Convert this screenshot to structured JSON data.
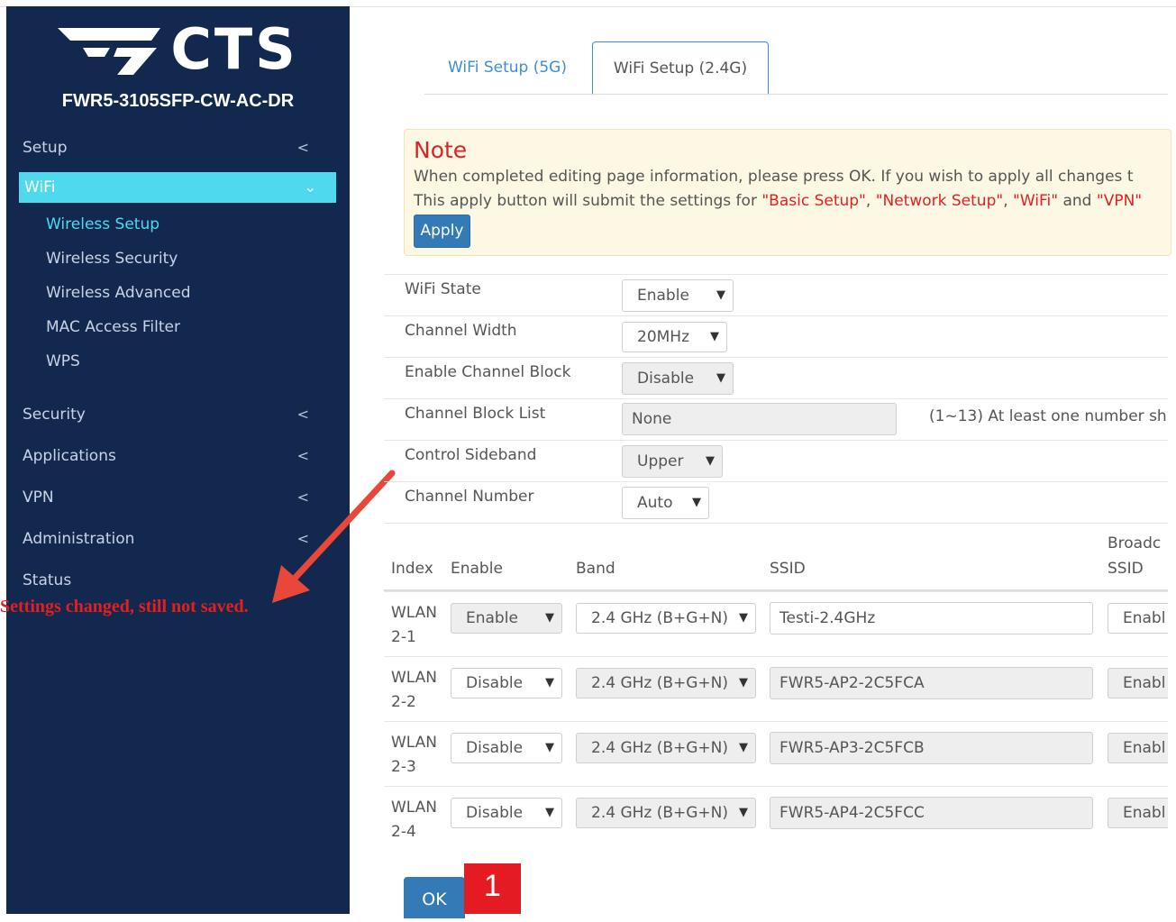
{
  "brand": {
    "logo_text": "CTS",
    "model": "FWR5-3105SFP-CW-AC-DR"
  },
  "sidebar": {
    "items": [
      {
        "label": "Setup",
        "chevron": "<"
      },
      {
        "label": "WiFi",
        "chevron": "⌄"
      },
      {
        "label": "Security",
        "chevron": "<"
      },
      {
        "label": "Applications",
        "chevron": "<"
      },
      {
        "label": "VPN",
        "chevron": "<"
      },
      {
        "label": "Administration",
        "chevron": "<"
      },
      {
        "label": "Status"
      }
    ],
    "wifi_subitems": [
      "Wireless Setup",
      "Wireless Security",
      "Wireless Advanced",
      "MAC Access Filter",
      "WPS"
    ],
    "warning": "Settings changed, still not saved."
  },
  "tabs": [
    {
      "label": "WiFi Setup (5G)"
    },
    {
      "label": "WiFi Setup (2.4G)",
      "active": true
    }
  ],
  "note": {
    "title": "Note",
    "line1": "When completed editing page information, please press OK. If you wish to apply all changes t",
    "line2_prefix": "This apply button will submit the settings for ",
    "line2_q1": "\"Basic Setup\"",
    "line2_sep1": ", ",
    "line2_q2": "\"Network Setup\"",
    "line2_sep2": ", ",
    "line2_q3": "\"WiFi\"",
    "line2_and": " and ",
    "line2_q4": "\"VPN\"",
    "apply_label": "Apply"
  },
  "settings": {
    "wifi_state": {
      "label": "WiFi State",
      "value": "Enable"
    },
    "channel_width": {
      "label": "Channel Width",
      "value": "20MHz"
    },
    "enable_channel_block": {
      "label": "Enable Channel Block",
      "value": "Disable"
    },
    "channel_block_list": {
      "label": "Channel Block List",
      "value": "None",
      "hint": "(1~13) At least one number sh"
    },
    "control_sideband": {
      "label": "Control Sideband",
      "value": "Upper"
    },
    "channel_number": {
      "label": "Channel Number",
      "value": "Auto"
    }
  },
  "wlan_table": {
    "headers": {
      "index": "Index",
      "enable": "Enable",
      "band": "Band",
      "ssid": "SSID",
      "broadcast1": "Broadc",
      "broadcast2": "SSID"
    },
    "rows": [
      {
        "index1": "WLAN",
        "index2": "2-1",
        "enable": "Enable",
        "band": "2.4 GHz (B+G+N)",
        "ssid": "Testi-2.4GHz",
        "broadcast": "Enabl"
      },
      {
        "index1": "WLAN",
        "index2": "2-2",
        "enable": "Disable",
        "band": "2.4 GHz (B+G+N)",
        "ssid": "FWR5-AP2-2C5FCA",
        "broadcast": "Enabl"
      },
      {
        "index1": "WLAN",
        "index2": "2-3",
        "enable": "Disable",
        "band": "2.4 GHz (B+G+N)",
        "ssid": "FWR5-AP3-2C5FCB",
        "broadcast": "Enabl"
      },
      {
        "index1": "WLAN",
        "index2": "2-4",
        "enable": "Disable",
        "band": "2.4 GHz (B+G+N)",
        "ssid": "FWR5-AP4-2C5FCC",
        "broadcast": "Enabl"
      }
    ]
  },
  "ok_label": "OK",
  "annotation_badge": "1",
  "colors": {
    "sidebar": "#13284e",
    "active": "#4fd9ee",
    "button": "#337ab7",
    "warning": "#e41f1f"
  }
}
